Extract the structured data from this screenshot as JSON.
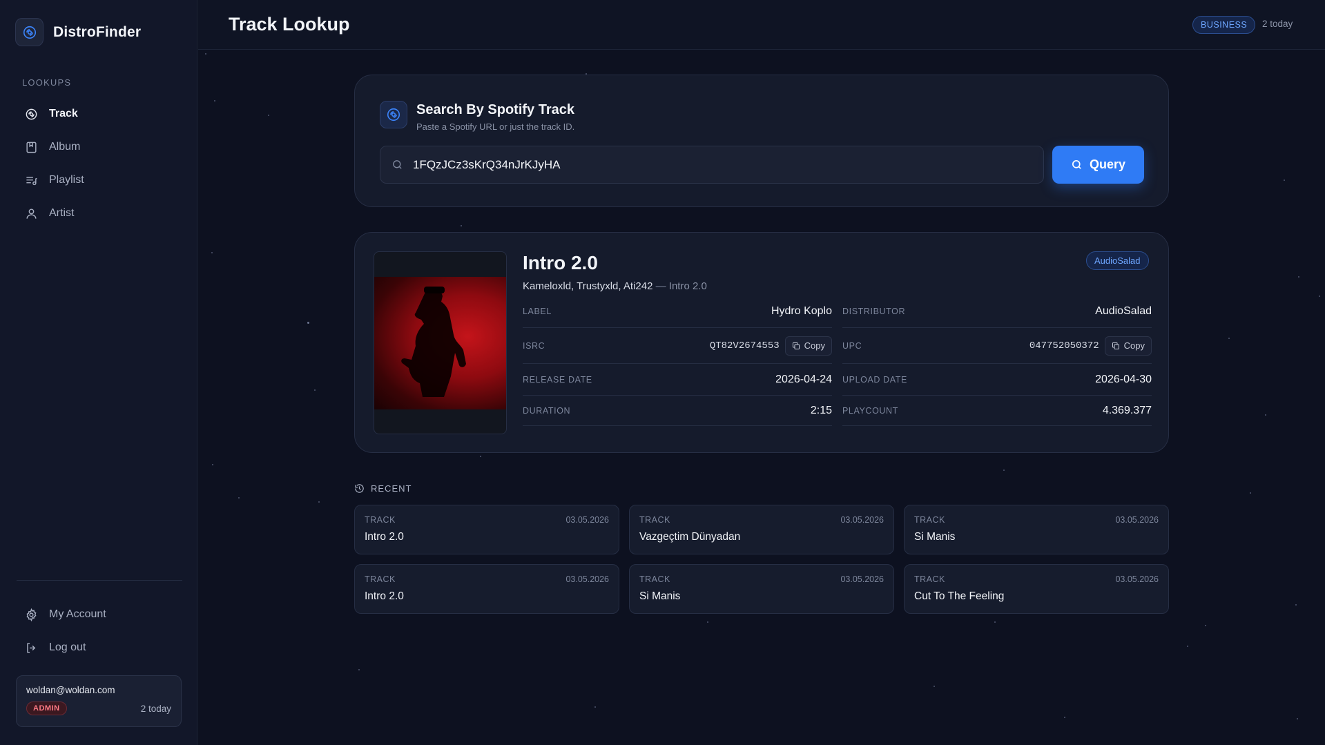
{
  "app": {
    "name": "DistroFinder"
  },
  "sidebar": {
    "section_label": "LOOKUPS",
    "items": [
      {
        "label": "Track",
        "icon": "disc-icon",
        "active": true
      },
      {
        "label": "Album",
        "icon": "album-icon",
        "active": false
      },
      {
        "label": "Playlist",
        "icon": "playlist-icon",
        "active": false
      },
      {
        "label": "Artist",
        "icon": "user-icon",
        "active": false
      }
    ],
    "bottom": [
      {
        "label": "My Account",
        "icon": "gear-icon"
      },
      {
        "label": "Log out",
        "icon": "logout-icon"
      }
    ],
    "account": {
      "email": "woldan@woldan.com",
      "role": "ADMIN",
      "usage": "2 today"
    }
  },
  "header": {
    "title": "Track Lookup",
    "plan": "BUSINESS",
    "usage": "2 today"
  },
  "search": {
    "title": "Search By Spotify Track",
    "subtitle": "Paste a Spotify URL or just the track ID.",
    "value": "1FQzJCz3sKrQ34nJrKJyHA",
    "button_label": "Query"
  },
  "result": {
    "title": "Intro 2.0",
    "artists": "Kameloxld, Trustyxld, Ati242",
    "separator": "—",
    "album": "Intro 2.0",
    "distributor_badge": "AudioSalad",
    "copy_label": "Copy",
    "fields": {
      "label": {
        "name": "LABEL",
        "value": "Hydro Koplo"
      },
      "distributor": {
        "name": "DISTRIBUTOR",
        "value": "AudioSalad"
      },
      "isrc": {
        "name": "ISRC",
        "value": "QT82V2674553"
      },
      "upc": {
        "name": "UPC",
        "value": "047752050372"
      },
      "release_date": {
        "name": "RELEASE DATE",
        "value": "2026-04-24"
      },
      "upload_date": {
        "name": "UPLOAD DATE",
        "value": "2026-04-30"
      },
      "duration": {
        "name": "DURATION",
        "value": "2:15"
      },
      "playcount": {
        "name": "PLAYCOUNT",
        "value": "4.369.377"
      }
    }
  },
  "recent": {
    "label": "RECENT",
    "items": [
      {
        "type": "TRACK",
        "date": "03.05.2026",
        "title": "Intro 2.0"
      },
      {
        "type": "TRACK",
        "date": "03.05.2026",
        "title": "Vazgeçtim Dünyadan"
      },
      {
        "type": "TRACK",
        "date": "03.05.2026",
        "title": "Si Manis"
      },
      {
        "type": "TRACK",
        "date": "03.05.2026",
        "title": "Intro 2.0"
      },
      {
        "type": "TRACK",
        "date": "03.05.2026",
        "title": "Si Manis"
      },
      {
        "type": "TRACK",
        "date": "03.05.2026",
        "title": "Cut To The Feeling"
      }
    ]
  },
  "colors": {
    "accent": "#2f7bf5",
    "background": "#0d1120",
    "admin": "#ff7a85"
  }
}
